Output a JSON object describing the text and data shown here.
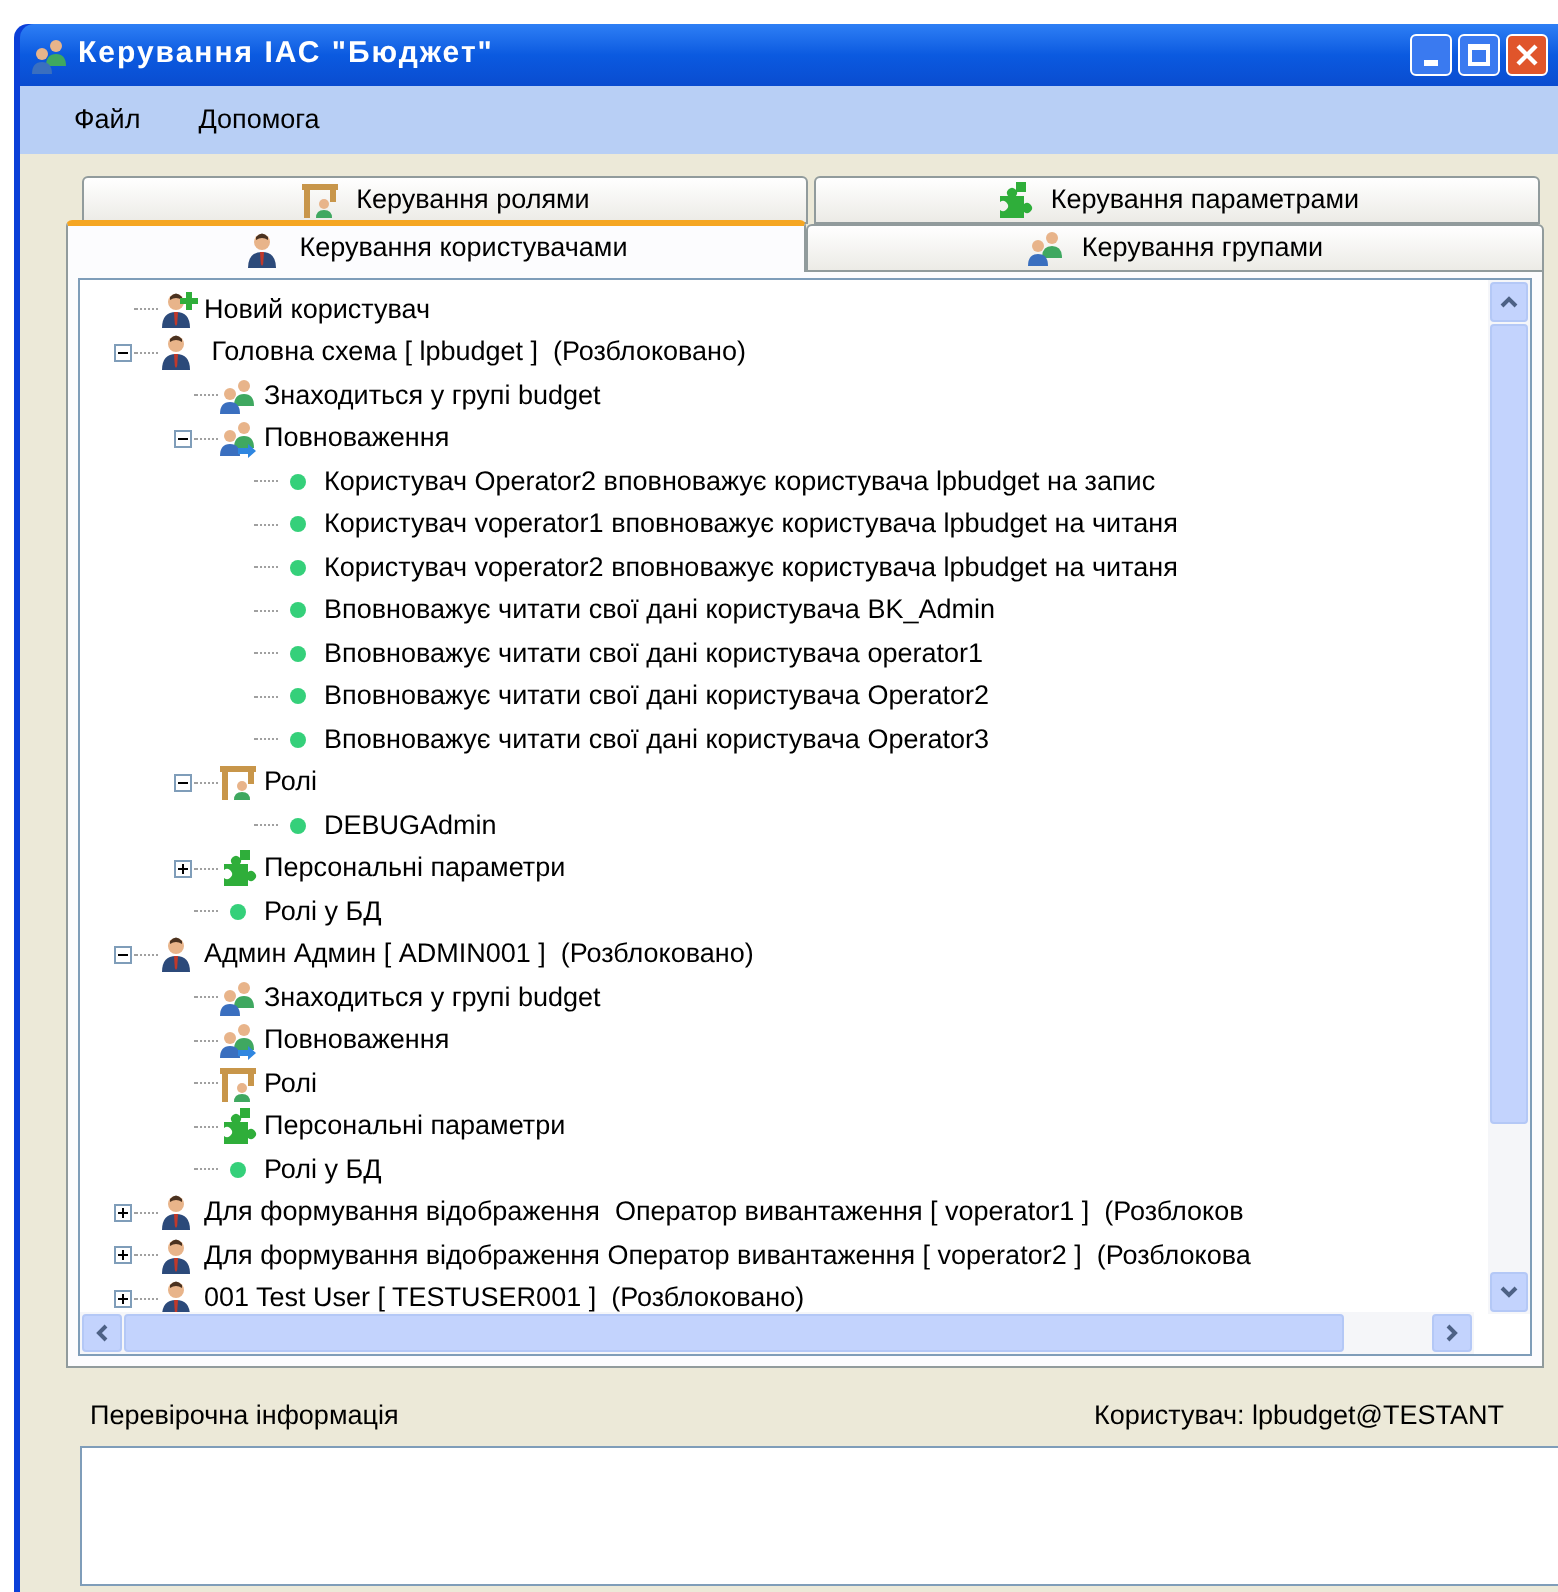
{
  "window": {
    "title": "Керування ІАС \"Бюджет\""
  },
  "menu": [
    "Файл",
    "Допомога"
  ],
  "tab_rows": [
    [
      {
        "label": "Керування ролями",
        "kind": "roles",
        "selected": false
      },
      {
        "label": "Керування параметрами",
        "kind": "params",
        "selected": false
      }
    ],
    [
      {
        "label": "Керування користувачами",
        "kind": "user",
        "selected": true
      },
      {
        "label": "Керування групами",
        "kind": "group",
        "selected": false
      }
    ]
  ],
  "tree": [
    {
      "label": "Новий користувач",
      "kind": "new-user"
    },
    {
      "label": " Головна схема [ lpbudget ]  (Розблоковано)",
      "kind": "user",
      "expanded": true,
      "children": [
        {
          "label": "Знаходиться у групі budget",
          "kind": "group"
        },
        {
          "label": "Повноваження",
          "kind": "permissions",
          "expanded": true,
          "children": [
            {
              "label": "Користувач Operator2 вповноважує користувача lpbudget на запис",
              "kind": "bullet"
            },
            {
              "label": "Користувач voperator1 вповноважує користувача lpbudget на читаня",
              "kind": "bullet"
            },
            {
              "label": "Користувач voperator2 вповноважує користувача lpbudget на читаня",
              "kind": "bullet"
            },
            {
              "label": "Вповноважує читати свої дані користувача BK_Admin",
              "kind": "bullet"
            },
            {
              "label": "Вповноважує читати свої дані користувача operator1",
              "kind": "bullet"
            },
            {
              "label": "Вповноважує читати свої дані користувача Operator2",
              "kind": "bullet"
            },
            {
              "label": "Вповноважує читати свої дані користувача Operator3",
              "kind": "bullet"
            }
          ]
        },
        {
          "label": "Ролі",
          "kind": "roles",
          "expanded": true,
          "children": [
            {
              "label": "DEBUGAdmin",
              "kind": "bullet"
            }
          ]
        },
        {
          "label": "Персональні параметри",
          "kind": "params",
          "expanded": false
        },
        {
          "label": "Ролі у БД",
          "kind": "bullet"
        }
      ]
    },
    {
      "label": "Админ Админ [ ADMIN001 ]  (Розблоковано)",
      "kind": "user",
      "expanded": true,
      "children": [
        {
          "label": "Знаходиться у групі budget",
          "kind": "group"
        },
        {
          "label": "Повноваження",
          "kind": "permissions"
        },
        {
          "label": "Ролі",
          "kind": "roles"
        },
        {
          "label": "Персональні параметри",
          "kind": "params"
        },
        {
          "label": "Ролі у БД",
          "kind": "bullet"
        }
      ]
    },
    {
      "label": "Для формування відображення  Оператор вивантаження [ voperator1 ]  (Розблоков",
      "kind": "user",
      "expanded": false
    },
    {
      "label": "Для формування відображення Оператор вивантаження [ voperator2 ]  (Розблокова",
      "kind": "user",
      "expanded": false
    },
    {
      "label": "001 Test User [ TESTUSER001 ]  (Розблоковано)",
      "kind": "user",
      "expanded": false
    }
  ],
  "info": {
    "label": "Перевірочна інформація",
    "user": "Користувач: lpbudget@TESTANT"
  }
}
